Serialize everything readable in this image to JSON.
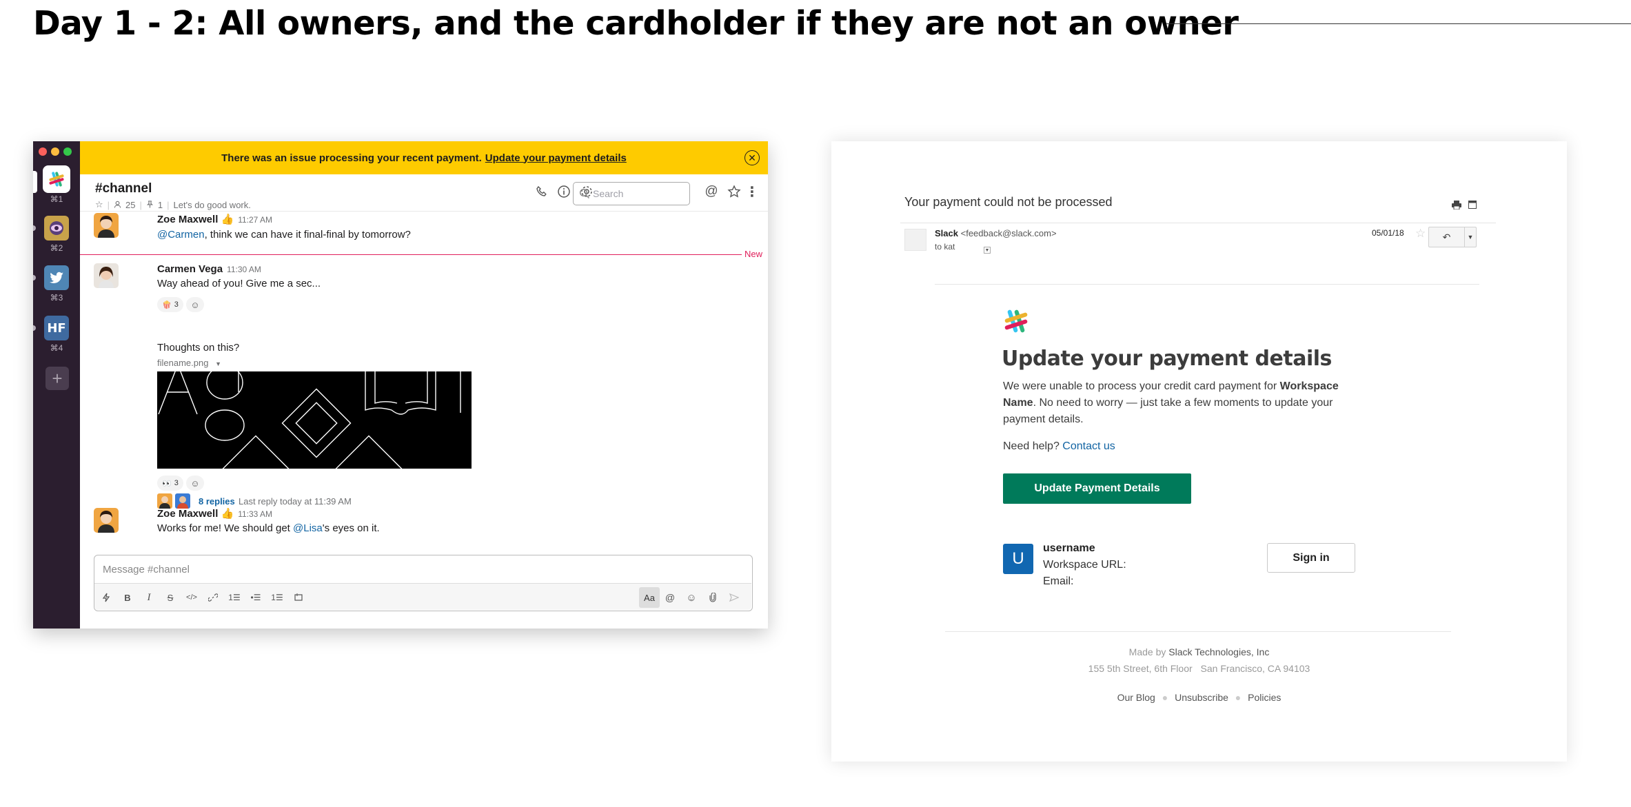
{
  "page": {
    "heading": "Day 1 - 2: All owners, and the cardholder if they are not an owner"
  },
  "slack": {
    "workspaces": [
      {
        "key": "⌘1",
        "icon": "slack-logo-icon"
      },
      {
        "key": "⌘2",
        "icon": "eye-workspace-icon"
      },
      {
        "key": "⌘3",
        "icon": "twitter-bird-icon"
      },
      {
        "key": "⌘4",
        "label": "HF"
      }
    ],
    "add_workspace": "+",
    "banner": {
      "text": "There was an issue processing your recent payment.",
      "link": "Update your payment details",
      "close": "✕"
    },
    "channel": {
      "name": "#channel",
      "members": "25",
      "pinned": "1",
      "topic": "Let's do good work."
    },
    "search_placeholder": "Search",
    "new_label": "New",
    "messages": [
      {
        "name": "Zoe Maxwell 👍",
        "time": "11:27 AM",
        "mention": "@Carmen",
        "text": ", think we can have it final-final by tomorrow?"
      },
      {
        "name": "Carmen Vega",
        "time": "11:30 AM",
        "text": "Way ahead of you! Give me a sec...",
        "reaction_emoji": "🍿",
        "reaction_count": "3",
        "text2": "Thoughts on this?",
        "file": "filename.png",
        "reaction2_emoji": "👀",
        "reaction2_count": "3",
        "replies": "8 replies",
        "last_reply": "Last reply today at 11:39 AM"
      },
      {
        "name": "Zoe Maxwell 👍",
        "time": "11:33 AM",
        "text_before": "Works for me! We should get ",
        "mention": "@Lisa",
        "text_after": "'s eyes on it."
      }
    ],
    "composer": {
      "placeholder": "Message #channel",
      "aa": "Aa"
    },
    "colors": {
      "banner": "#fecb00",
      "sidebar": "#2b1e2f",
      "new_divider": "#e01e5a",
      "link": "#1264a3"
    }
  },
  "email": {
    "subject": "Your payment could not be processed",
    "sender_name": "Slack",
    "sender_addr": "<feedback@slack.com>",
    "to": "to kat",
    "date": "05/01/18",
    "title": "Update your payment details",
    "body_1": "We were unable to process your credit card payment for ",
    "body_bold": "Workspace Name",
    "body_2": ". No need to worry — just take a few moments to update your payment details.",
    "help_text": "Need help?",
    "help_link": "Contact us",
    "cta": "Update Payment Details",
    "avatar_letter": "U",
    "username": "username",
    "workspace_url_label": "Workspace URL:",
    "email_label": "Email:",
    "sign_in": "Sign in",
    "footer_made_by": "Made by",
    "footer_company": "Slack Technologies, Inc",
    "footer_street": "155 5th Street, 6th Floor",
    "footer_city": "San Francisco, CA  94103",
    "links": [
      "Our Blog",
      "Unsubscribe",
      "Policies"
    ],
    "colors": {
      "cta": "#007a5a",
      "avatar": "#1167b1"
    }
  }
}
